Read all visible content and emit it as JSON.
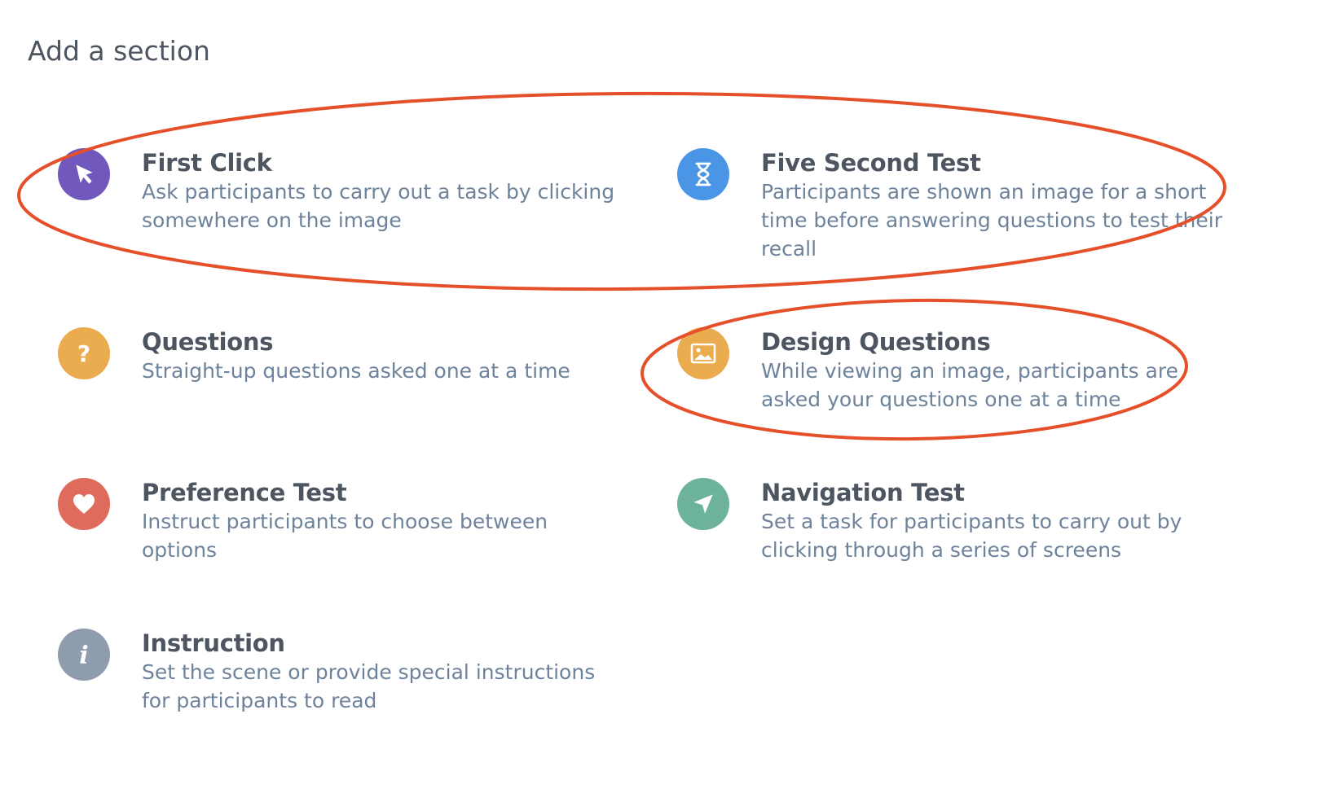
{
  "page": {
    "title": "Add a section"
  },
  "sections": [
    {
      "title": "First Click",
      "description": "Ask participants to carry out a task by clicking somewhere on the image",
      "icon": "cursor-arrow-icon",
      "color": "#7158bd"
    },
    {
      "title": "Five Second Test",
      "description": "Participants are shown an image for a short time before answering questions to test their recall",
      "icon": "hourglass-icon",
      "color": "#4b95e6"
    },
    {
      "title": "Questions",
      "description": "Straight-up questions asked one at a time",
      "icon": "question-mark-icon",
      "color": "#ebab4f"
    },
    {
      "title": "Design Questions",
      "description": "While viewing an image, participants are asked your questions one at a time",
      "icon": "image-icon",
      "color": "#ebab4f"
    },
    {
      "title": "Preference Test",
      "description": "Instruct participants to choose between options",
      "icon": "heart-icon",
      "color": "#df6b5d"
    },
    {
      "title": "Navigation Test",
      "description": "Set a task for participants to carry out by clicking through a series of screens",
      "icon": "navigation-arrow-icon",
      "color": "#6cb29c"
    },
    {
      "title": "Instruction",
      "description": "Set the scene or provide special instructions for participants to read",
      "icon": "info-icon",
      "color": "#8e9cae"
    }
  ],
  "annotations": {
    "color": "#e5502b"
  }
}
